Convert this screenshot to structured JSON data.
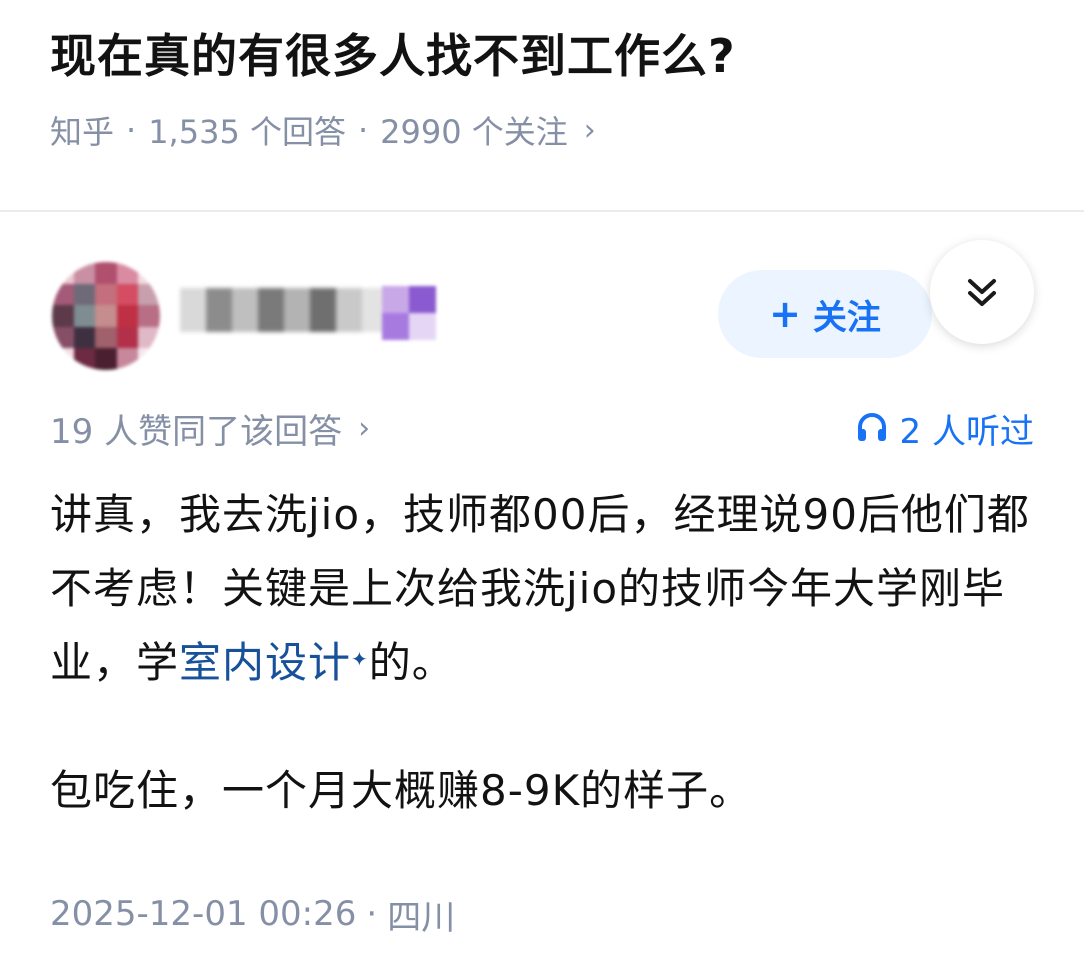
{
  "question": {
    "title": "现在真的有很多人找不到工作么?",
    "source": "知乎",
    "answers": "1,535 个回答",
    "followers": "2990 个关注",
    "separator": "·",
    "chevron": "›"
  },
  "author": {
    "avatar_icon": "blurred-avatar",
    "follow_plus": "+",
    "follow_label": "关注",
    "collapse_icon": "double-chevron-down-icon"
  },
  "stats": {
    "likes": "19 人赞同了该回答",
    "chevron": "›",
    "listen_icon": "headphones-icon",
    "listened": "2 人听过"
  },
  "answer": {
    "p1_before": "讲真，我去洗jio，技师都00后，经理说90后他们都不考虑！关键是上次给我洗jio的技师今年大学刚毕业，学",
    "p1_link": "室内设计",
    "p1_link_mark": "✦",
    "p1_after": "的。",
    "p2": "包吃住，一个月大概赚8-9K的样子。"
  },
  "footer": {
    "datetime": "2025-12-01 00:26",
    "separator": "·",
    "location": "四川"
  },
  "colors": {
    "accent": "#1772f6",
    "link": "#175199",
    "meta": "#8590a6",
    "follow_bg": "#ebf4ff"
  }
}
